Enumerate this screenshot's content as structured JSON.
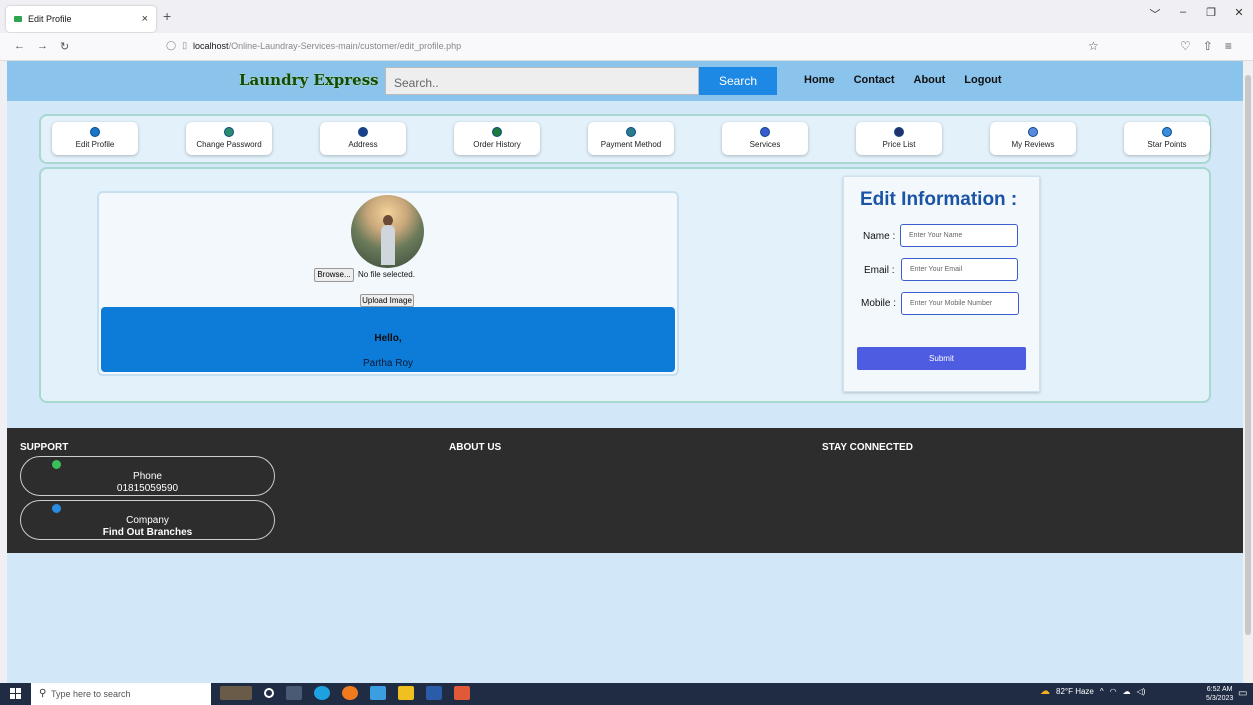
{
  "browser": {
    "tab_title": "Edit Profile",
    "tab_close": "×",
    "new_tab": "+",
    "url_host": "localhost",
    "url_path": "/Online-Laundray-Services-main/customer/edit_profile.php",
    "window_controls": [
      "﹀",
      "–",
      "❐",
      "✕"
    ]
  },
  "header": {
    "logo": "Laundry Express",
    "search_placeholder": "Search..",
    "search_button": "Search",
    "nav": [
      "Home",
      "Contact",
      "About",
      "Logout"
    ]
  },
  "menu": [
    {
      "label": "Edit Profile",
      "icon": "edit-icon"
    },
    {
      "label": "Change Password",
      "icon": "lock-icon"
    },
    {
      "label": "Address",
      "icon": "location-pin-icon"
    },
    {
      "label": "Order History",
      "icon": "history-icon"
    },
    {
      "label": "Payment Method",
      "icon": "payment-icon"
    },
    {
      "label": "Services",
      "icon": "services-icon"
    },
    {
      "label": "Price List",
      "icon": "price-icon"
    },
    {
      "label": "My Reviews",
      "icon": "review-icon"
    },
    {
      "label": "Star Points",
      "icon": "star-icon"
    }
  ],
  "profile": {
    "browse_label": "Browse...",
    "no_file": "No file selected.",
    "upload_label": "Upload Image",
    "greeting": "Hello,",
    "name": "Partha Roy"
  },
  "edit_form": {
    "title": "Edit Information :",
    "name_label": "Name :",
    "name_placeholder": "Enter Your Name",
    "email_label": "Email :",
    "email_placeholder": "Enter Your Email",
    "mobile_label": "Mobile :",
    "mobile_placeholder": "Enter Your Mobile Number",
    "submit_label": "Submit"
  },
  "footer": {
    "support_heading": "SUPPORT",
    "about_heading": "ABOUT US",
    "stay_heading": "STAY CONNECTED",
    "phone_label": "Phone",
    "phone_value": "01815059590",
    "company_label": "Company",
    "company_value": "Find Out Branches"
  },
  "taskbar": {
    "search_placeholder": "Type here to search",
    "weather": "82°F Haze",
    "time": "6:52 AM",
    "date": "5/3/2023"
  },
  "colors": {
    "header": "#8ac3ec",
    "page_bg": "#d2e7f7",
    "accent_blue": "#1e88e5",
    "footer": "#2d2d2d",
    "title_blue": "#1b54a4",
    "submit": "#4d5ce0"
  }
}
